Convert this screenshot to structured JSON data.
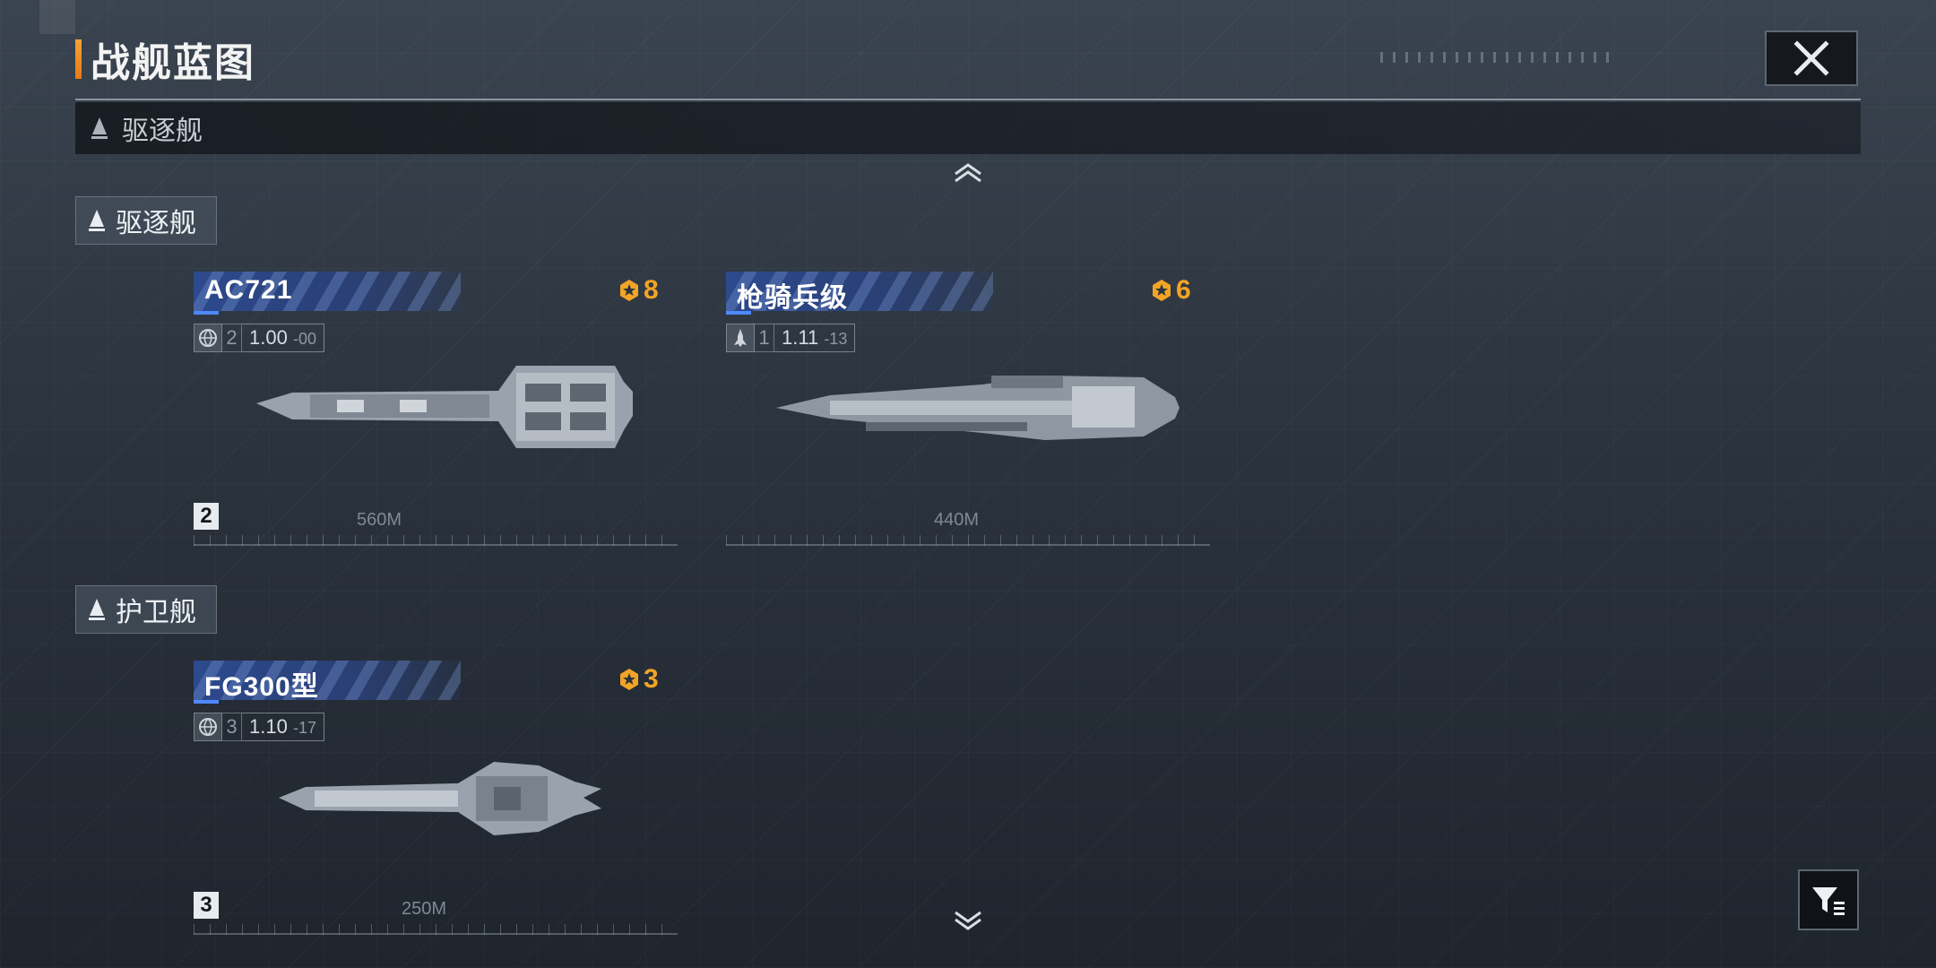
{
  "header": {
    "title": "战舰蓝图"
  },
  "strip": {
    "label": "驱逐舰"
  },
  "sections": [
    {
      "label": "驱逐舰",
      "ships": [
        {
          "name": "AC721",
          "score": "8",
          "count_small": "2",
          "version": "1.00",
          "version_suffix": "-00",
          "length": "560M",
          "owned": "2"
        },
        {
          "name": "枪骑兵级",
          "score": "6",
          "count_small": "1",
          "version": "1.11",
          "version_suffix": "-13",
          "length": "440M"
        }
      ]
    },
    {
      "label": "护卫舰",
      "ships": [
        {
          "name": "FG300型",
          "score": "3",
          "count_small": "3",
          "version": "1.10",
          "version_suffix": "-17",
          "length": "250M",
          "owned": "3"
        }
      ]
    }
  ],
  "icons": {
    "close": "close-icon",
    "filter": "filter-icon",
    "chevron_up": "chevron-up-icon",
    "chevron_down": "chevron-down-icon",
    "score": "medal-icon",
    "ship_class": "ship-class-icon",
    "globe": "globe-icon",
    "rocket": "rocket-icon"
  },
  "colors": {
    "accent": "#f1a425",
    "name_bar": "#2c4a8e",
    "highlight": "#4f88ff"
  }
}
